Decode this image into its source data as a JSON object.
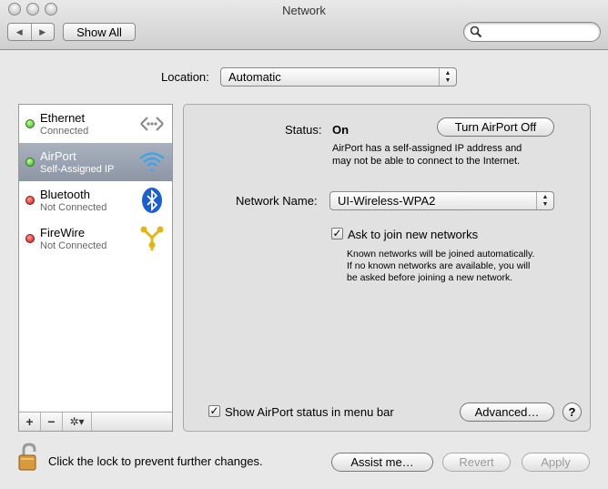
{
  "window": {
    "title": "Network"
  },
  "toolbar": {
    "back_glyph": "◀",
    "forward_glyph": "▶",
    "show_all": "Show All",
    "search_placeholder": ""
  },
  "location": {
    "label": "Location:",
    "value": "Automatic"
  },
  "services": [
    {
      "name": "Ethernet",
      "status": "Connected",
      "status_color": "green",
      "icon": "ethernet-icon"
    },
    {
      "name": "AirPort",
      "status": "Self-Assigned IP",
      "status_color": "green",
      "icon": "wifi-icon",
      "selected": true
    },
    {
      "name": "Bluetooth",
      "status": "Not Connected",
      "status_color": "red",
      "icon": "bluetooth-icon"
    },
    {
      "name": "FireWire",
      "status": "Not Connected",
      "status_color": "red",
      "icon": "firewire-icon"
    }
  ],
  "sidebar_controls": {
    "add": "+",
    "remove": "−",
    "gear": "✲▾"
  },
  "airport": {
    "status_label": "Status:",
    "status_value": "On",
    "turn_off_button": "Turn AirPort Off",
    "status_desc_line1": "AirPort has a self-assigned IP address and",
    "status_desc_line2": "may not be able to connect to the Internet.",
    "network_name_label": "Network Name:",
    "network_name_value": "UI-Wireless-WPA2",
    "ask_join_label": "Ask to join new networks",
    "ask_join_checked": true,
    "ask_desc_line1": "Known networks will be joined automatically.",
    "ask_desc_line2": "If no known networks are available, you will",
    "ask_desc_line3": "be asked before joining a new network.",
    "show_status_label": "Show AirPort status in menu bar",
    "show_status_checked": true,
    "advanced_button": "Advanced…",
    "help_glyph": "?"
  },
  "footer": {
    "lock_text": "Click the lock to prevent further changes.",
    "assist_button": "Assist me…",
    "revert_button": "Revert",
    "apply_button": "Apply"
  },
  "colors": {
    "selection": "#8d96a6",
    "green_dot": "#2fa81a",
    "red_dot": "#c51515"
  }
}
